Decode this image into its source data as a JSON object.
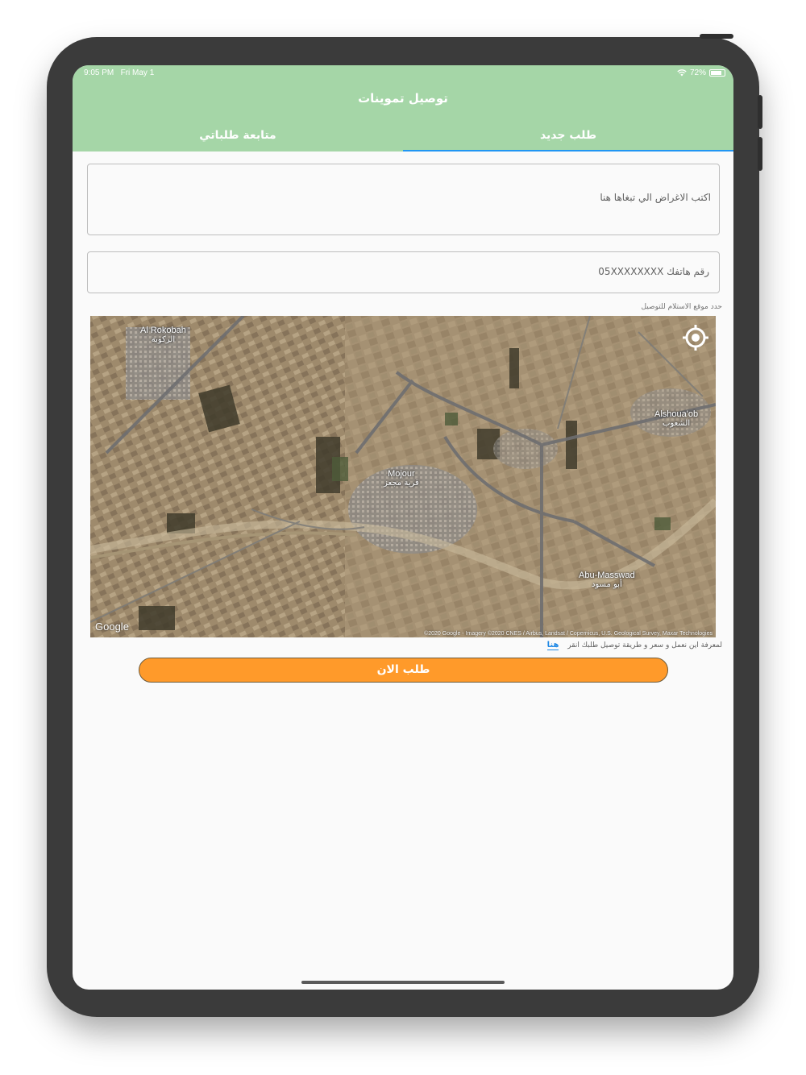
{
  "status_bar": {
    "time": "9:05 PM",
    "date": "Fri May 1",
    "battery": "72%",
    "wifi_icon": "wifi-icon",
    "battery_icon": "battery-icon"
  },
  "header": {
    "title": "توصيل تموينات",
    "background_color": "#a5d6a7",
    "tabs": [
      {
        "label": "طلب جديد",
        "selected": true
      },
      {
        "label": "متابعة طلباتي",
        "selected": false
      }
    ],
    "indicator_color": "#2196f3"
  },
  "form": {
    "items_placeholder": "اكتب الاغراض الي تبغاها هنا",
    "phone_placeholder": "رقم هاتفك 05XXXXXXXX",
    "map_label": "حدد موقع الاستلام للتوصيل"
  },
  "map": {
    "places": [
      {
        "en": "Al Rokobah",
        "ar": "الركوبة"
      },
      {
        "en": "Alshoua'ob",
        "ar": "الشعوب"
      },
      {
        "en": "Mojour",
        "ar": "قرية مجعز"
      },
      {
        "en": "Abu-Masswad",
        "ar": "أبو مسود"
      }
    ],
    "logo": "Google",
    "attribution": "©2020 Google - Imagery ©2020 CNES / Airbus, Landsat / Copernicus, U.S. Geological Survey, Maxar Technologies",
    "locate_icon": "locate-icon"
  },
  "info": {
    "text": "لمعرفة اين نعمل و سعر و طريقة توصيل طلبك انقر",
    "link": "هنا",
    "link_color": "#1e88e5"
  },
  "order_button": {
    "label": "طلب الان",
    "color": "#ff9a2a"
  }
}
